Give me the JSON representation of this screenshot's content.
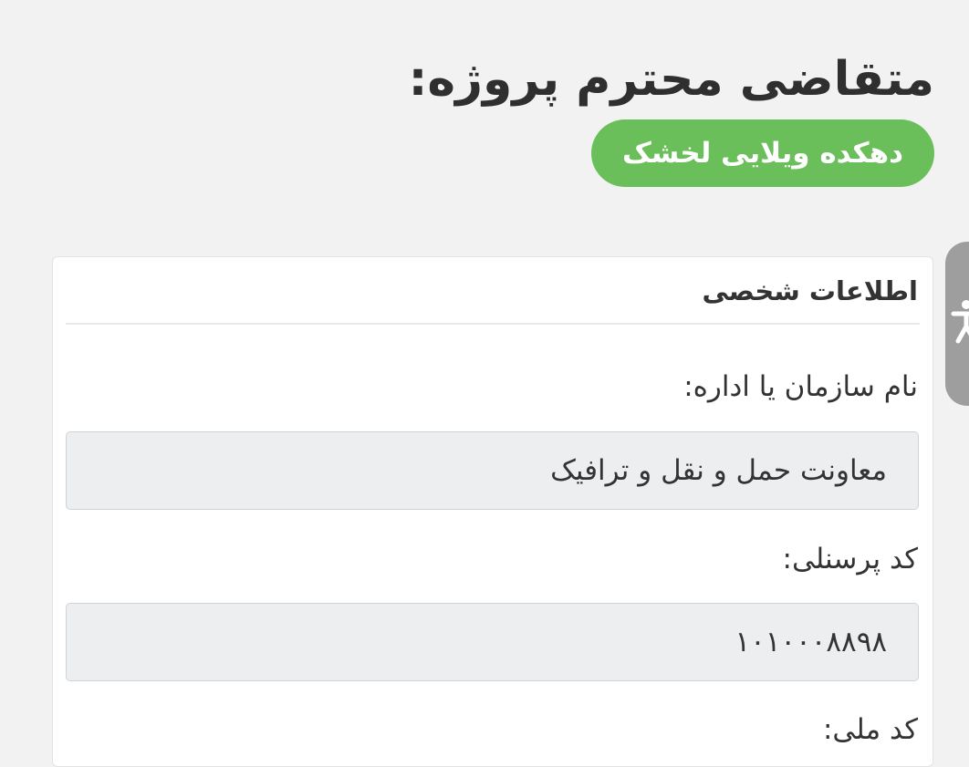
{
  "header": {
    "title": "متقاضی محترم پروژه:",
    "project_name": "دهکده ویلایی لخشک"
  },
  "personal_info": {
    "heading": "اطلاعات شخصی",
    "organization": {
      "label": "نام سازمان یا اداره:",
      "value": "معاونت حمل و نقل و ترافیک"
    },
    "personnel_code": {
      "label": "کد پرسنلی:",
      "value": "۱۰۱۰۰۰۸۸۹۸"
    },
    "national_code": {
      "label": "کد ملی:"
    }
  },
  "accessibility": {
    "icon": "accessibility-person-icon"
  },
  "colors": {
    "accent_green": "#6abf5a",
    "page_background": "#f2f2f2",
    "input_background": "#eceeef",
    "side_tab": "#9e9e9e"
  }
}
